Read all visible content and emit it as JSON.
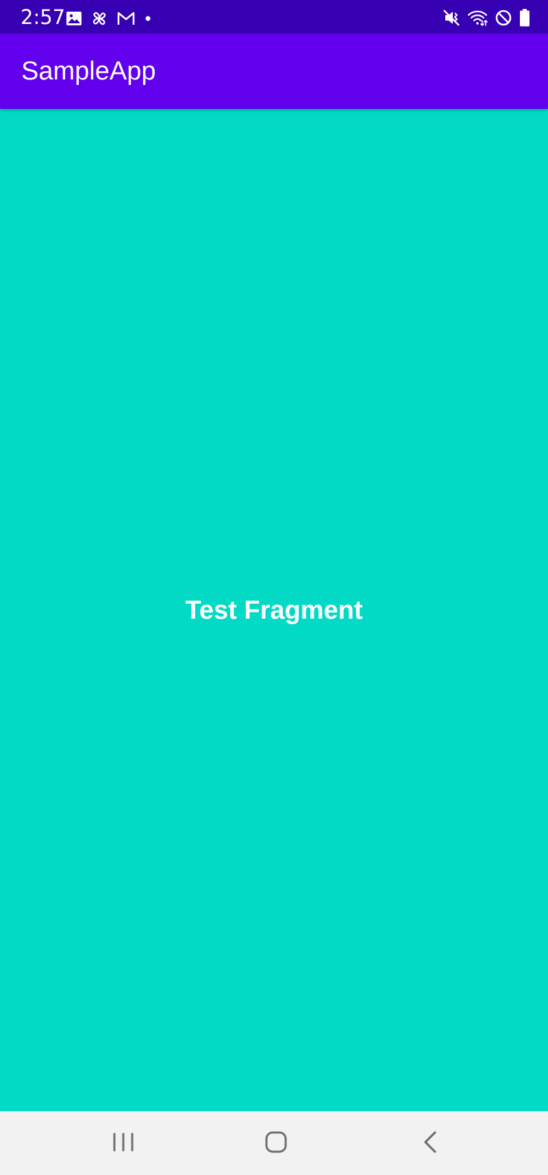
{
  "status_bar": {
    "time": "2:57",
    "left_icons": [
      "gallery-icon",
      "pinwheel-icon",
      "gmail-icon",
      "notification-dot-icon"
    ],
    "right_icons": [
      "vibrate-mute-icon",
      "wifi-icon",
      "do-not-disturb-icon",
      "battery-icon"
    ]
  },
  "app_bar": {
    "title": "SampleApp"
  },
  "content": {
    "text": "Test Fragment"
  },
  "nav_bar": {
    "buttons": [
      "recents-icon",
      "home-icon",
      "back-icon"
    ]
  },
  "colors": {
    "status_bar": "#3700B3",
    "app_bar": "#6200EE",
    "content_background": "#03DAC5",
    "nav_bar": "#F2F2F2",
    "nav_icon": "#6E6E6E"
  }
}
